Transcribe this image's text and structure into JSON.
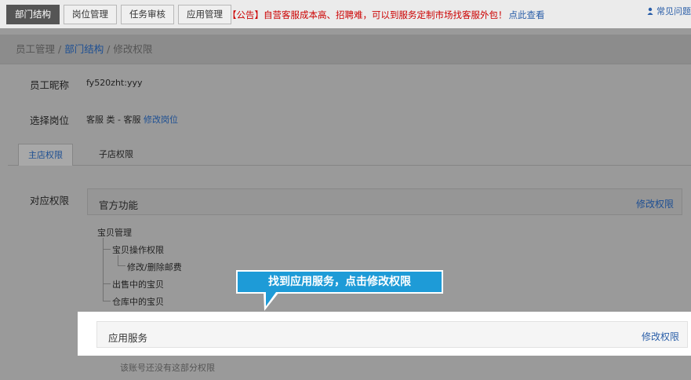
{
  "topbar": {
    "tabs": [
      {
        "label": "部门结构",
        "active": true
      },
      {
        "label": "岗位管理",
        "active": false
      },
      {
        "label": "任务审核",
        "active": false
      },
      {
        "label": "应用管理",
        "active": false
      }
    ],
    "notice_text": "【公告】自营客服成本高、招聘难，可以到服务定制市场找客服外包！",
    "notice_link": "点此查看",
    "faq_label": "常见问题"
  },
  "breadcrumb": {
    "root": "员工管理",
    "sep1": " / ",
    "parent": "部门结构",
    "sep2": " / ",
    "current": "修改权限"
  },
  "form": {
    "nickname_label": "员工昵称",
    "nickname_value": "fy520zht:yyy",
    "position_label": "选择岗位",
    "position_value": "客服 类 - 客服",
    "position_link": "修改岗位"
  },
  "subtabs": {
    "main": "主店权限",
    "sub": "子店权限"
  },
  "permissions": {
    "label": "对应权限",
    "official": {
      "title": "官方功能",
      "edit_label": "修改权限"
    },
    "tree": [
      "宝贝管理",
      "宝贝操作权限",
      "修改/删除邮费",
      "出售中的宝贝",
      "仓库中的宝贝"
    ],
    "app_service": {
      "title": "应用服务",
      "edit_label": "修改权限"
    },
    "empty_note": "该账号还没有这部分权限"
  },
  "callout": {
    "text": "找到应用服务，点击修改权限"
  },
  "colors": {
    "accent_blue": "#1e9bd7",
    "link_blue": "#2a5ea8",
    "notice_red": "#cc0000"
  }
}
